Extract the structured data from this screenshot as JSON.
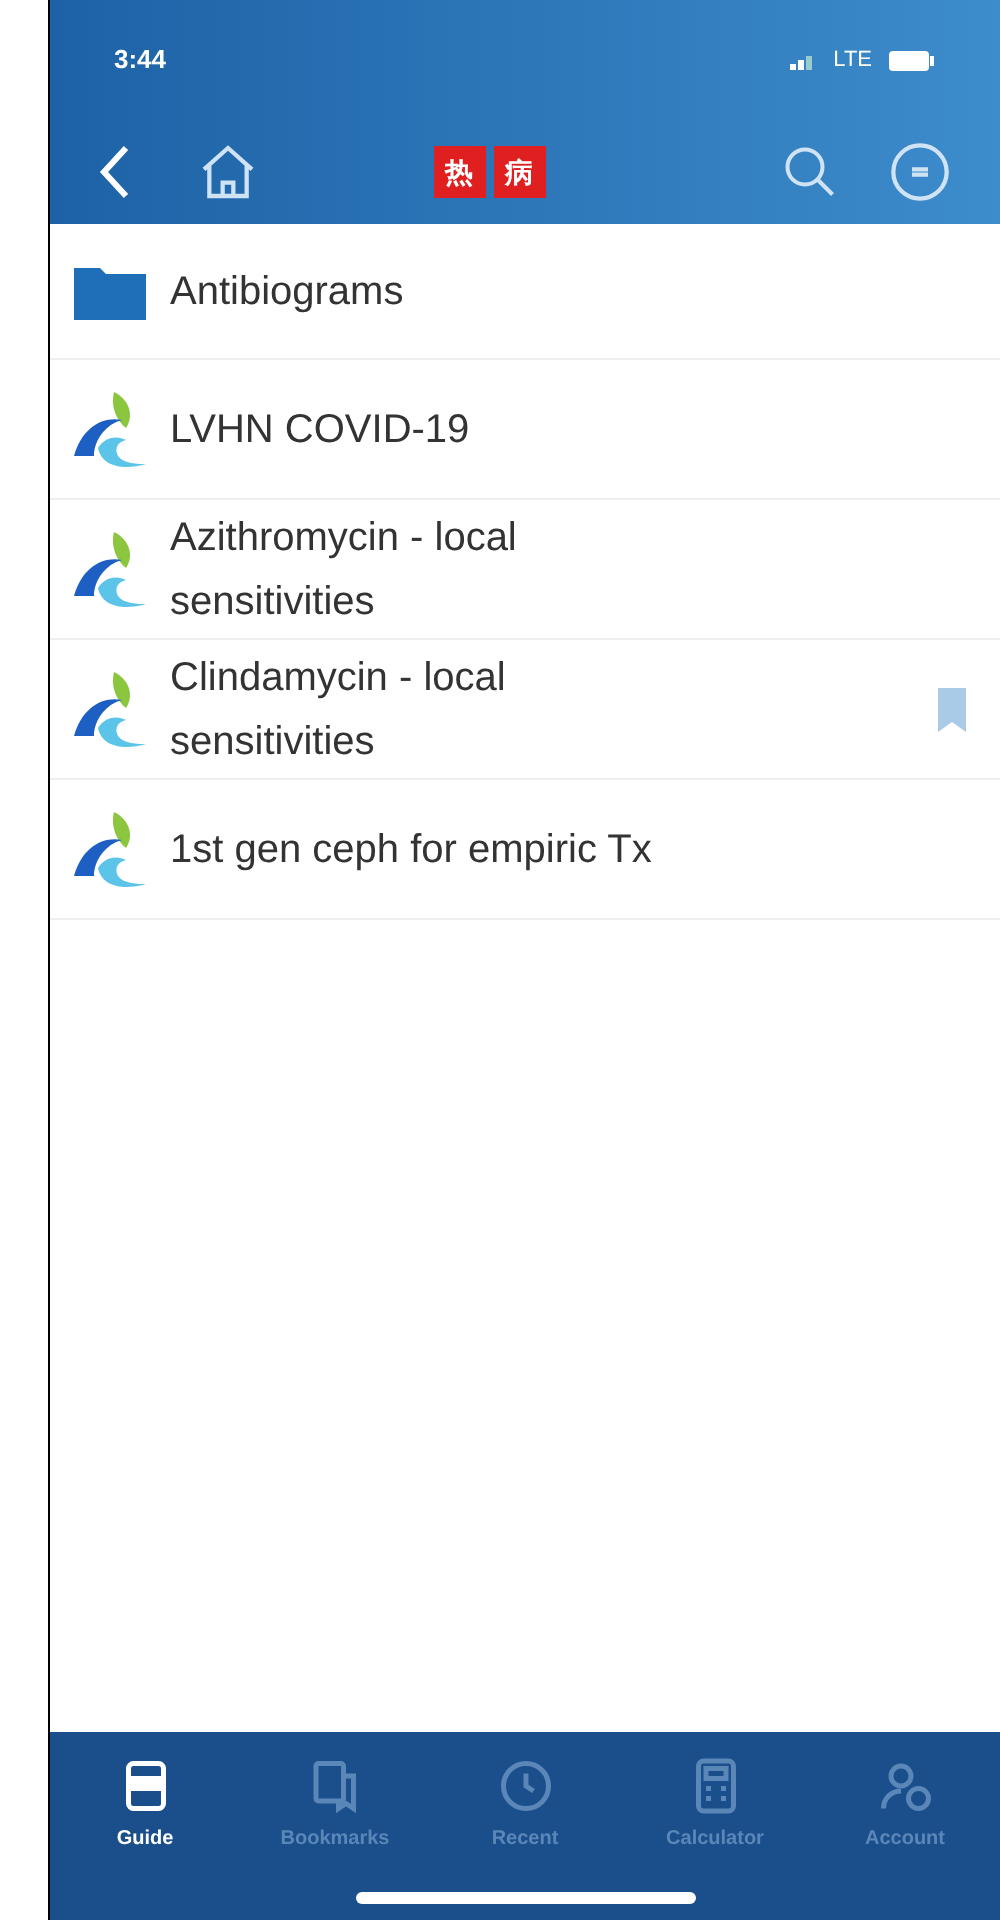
{
  "status_bar": {
    "time": "3:44",
    "network": "LTE"
  },
  "nav": {
    "logo": [
      "热",
      "病"
    ]
  },
  "items": [
    {
      "kind": "folder",
      "label": "Antibiograms",
      "bookmarked": false
    },
    {
      "kind": "document",
      "label": "LVHN COVID-19",
      "bookmarked": false
    },
    {
      "kind": "document",
      "label": "Azithromycin - local sensitivities",
      "bookmarked": false
    },
    {
      "kind": "document",
      "label": "Clindamycin - local sensitivities",
      "bookmarked": true
    },
    {
      "kind": "document",
      "label": "1st gen ceph for empiric Tx",
      "bookmarked": false
    }
  ],
  "tabs": [
    {
      "label": "Guide",
      "selected": true
    },
    {
      "label": "Bookmarks",
      "selected": false
    },
    {
      "label": "Recent",
      "selected": false
    },
    {
      "label": "Calculator",
      "selected": false
    },
    {
      "label": "Account",
      "selected": false
    }
  ]
}
